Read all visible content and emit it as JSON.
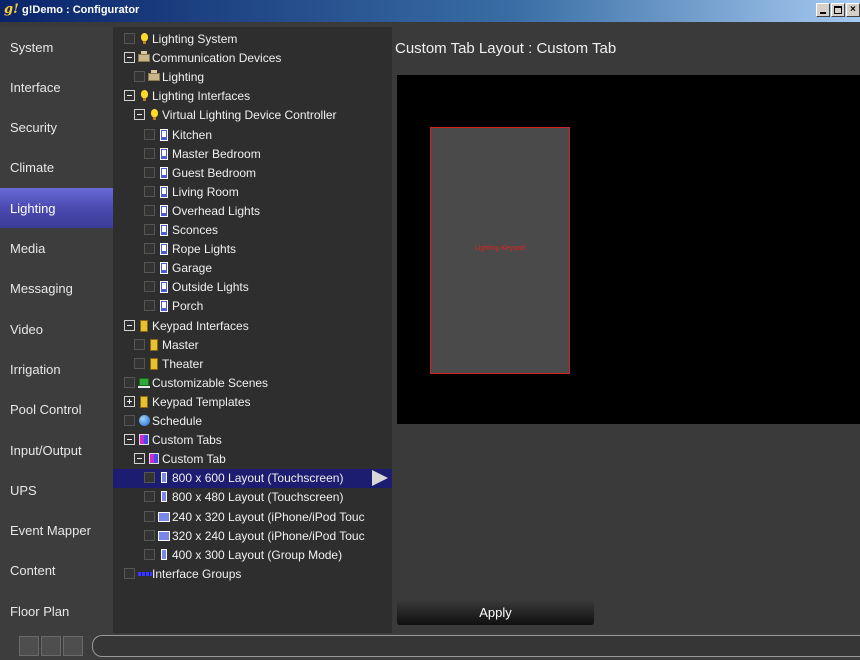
{
  "window": {
    "logo": "g!",
    "title": "g!Demo : Configurator"
  },
  "sidebar": {
    "items": [
      {
        "label": "System",
        "active": false
      },
      {
        "label": "Interface",
        "active": false
      },
      {
        "label": "Security",
        "active": false
      },
      {
        "label": "Climate",
        "active": false
      },
      {
        "label": "Lighting",
        "active": true
      },
      {
        "label": "Media",
        "active": false
      },
      {
        "label": "Messaging",
        "active": false
      },
      {
        "label": "Video",
        "active": false
      },
      {
        "label": "Irrigation",
        "active": false
      },
      {
        "label": "Pool Control",
        "active": false
      },
      {
        "label": "Input/Output",
        "active": false
      },
      {
        "label": "UPS",
        "active": false
      },
      {
        "label": "Event Mapper",
        "active": false
      },
      {
        "label": "Content",
        "active": false
      },
      {
        "label": "Floor Plan",
        "active": false
      }
    ]
  },
  "tree": {
    "items": [
      {
        "label": "Lighting System",
        "icon": "bulb",
        "control": "checkbox",
        "level": 0
      },
      {
        "label": "Communication Devices",
        "icon": "devices",
        "control": "expander-minus",
        "level": 0
      },
      {
        "label": "Lighting",
        "icon": "devices",
        "control": "checkbox",
        "level": 1
      },
      {
        "label": "Lighting Interfaces",
        "icon": "bulb",
        "control": "expander-minus",
        "level": 0
      },
      {
        "label": "Virtual Lighting Device Controller",
        "icon": "bulb",
        "control": "expander-minus",
        "level": 1
      },
      {
        "label": "Kitchen",
        "icon": "keypad-blue",
        "control": "checkbox",
        "level": 2
      },
      {
        "label": "Master Bedroom",
        "icon": "keypad-blue",
        "control": "checkbox",
        "level": 2
      },
      {
        "label": "Guest Bedroom",
        "icon": "keypad-blue",
        "control": "checkbox",
        "level": 2
      },
      {
        "label": "Living Room",
        "icon": "keypad-blue",
        "control": "checkbox",
        "level": 2
      },
      {
        "label": "Overhead Lights",
        "icon": "keypad-blue",
        "control": "checkbox",
        "level": 2
      },
      {
        "label": "Sconces",
        "icon": "keypad-blue",
        "control": "checkbox",
        "level": 2
      },
      {
        "label": "Rope Lights",
        "icon": "keypad-blue",
        "control": "checkbox",
        "level": 2
      },
      {
        "label": "Garage",
        "icon": "keypad-blue",
        "control": "checkbox",
        "level": 2
      },
      {
        "label": "Outside Lights",
        "icon": "keypad-blue",
        "control": "checkbox",
        "level": 2
      },
      {
        "label": "Porch",
        "icon": "keypad-blue",
        "control": "checkbox",
        "level": 2
      },
      {
        "label": "Keypad Interfaces",
        "icon": "keypad-yellow",
        "control": "expander-minus",
        "level": 0
      },
      {
        "label": "Master",
        "icon": "keypad-yellow",
        "control": "checkbox",
        "level": 1
      },
      {
        "label": "Theater",
        "icon": "keypad-yellow",
        "control": "checkbox",
        "level": 1
      },
      {
        "label": "Customizable Scenes",
        "icon": "scenes",
        "control": "checkbox",
        "level": 0
      },
      {
        "label": "Keypad Templates",
        "icon": "keypad-yellow",
        "control": "expander-plus",
        "level": 0
      },
      {
        "label": "Schedule",
        "icon": "schedule",
        "control": "checkbox",
        "level": 0
      },
      {
        "label": "Custom Tabs",
        "icon": "tabs",
        "control": "expander-minus",
        "level": 0
      },
      {
        "label": "Custom Tab",
        "icon": "tabs",
        "control": "expander-minus",
        "level": 1
      },
      {
        "label": "800 x 600 Layout (Touchscreen)",
        "icon": "layout-tall",
        "control": "checkbox",
        "level": 2,
        "selected": true
      },
      {
        "label": "800 x 480 Layout (Touchscreen)",
        "icon": "layout-tall",
        "control": "checkbox",
        "level": 2
      },
      {
        "label": "240 x 320 Layout (iPhone/iPod Touc",
        "icon": "layout-wide",
        "control": "checkbox",
        "level": 2
      },
      {
        "label": "320 x 240 Layout (iPhone/iPod Touc",
        "icon": "layout-wide",
        "control": "checkbox",
        "level": 2
      },
      {
        "label": "400 x 300 Layout (Group Mode)",
        "icon": "layout-tall",
        "control": "checkbox",
        "level": 2
      },
      {
        "label": "Interface Groups",
        "icon": "groups",
        "control": "checkbox",
        "level": 0
      }
    ]
  },
  "main": {
    "title": "Custom Tab Layout : Custom Tab",
    "widget_label": "Lighting Keypad",
    "apply_label": "Apply"
  },
  "colors": {
    "selected_row": "#1c1c70",
    "active_sidebar": "#4a4ab0",
    "widget_border": "#d02020"
  }
}
